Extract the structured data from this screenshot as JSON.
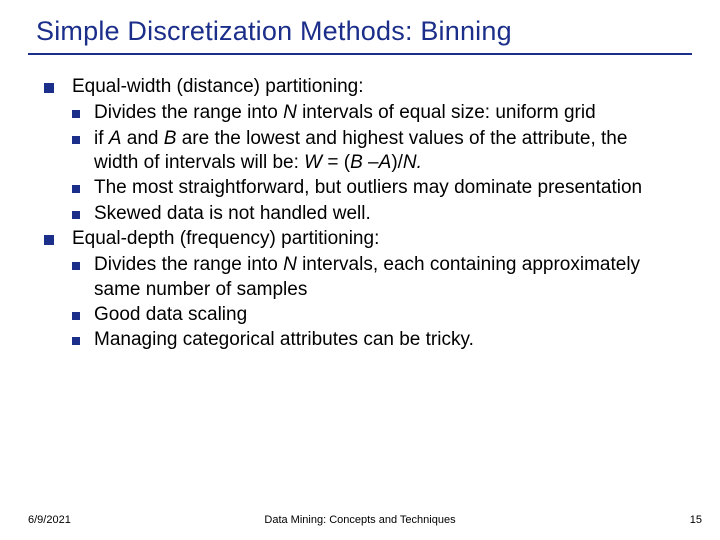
{
  "title": "Simple Discretization Methods: Binning",
  "top": {
    "a": {
      "head": "Equal-width (distance) partitioning:",
      "s1a": "Divides the range into ",
      "s1b": "N",
      "s1c": " intervals of equal size: uniform grid",
      "s2a": "if ",
      "s2b": "A",
      "s2c": " and ",
      "s2d": "B",
      "s2e": " are the lowest and highest values of the attribute, the width of intervals will be: ",
      "s2f": "W",
      "s2g": " = (",
      "s2h": "B",
      "s2i": " –",
      "s2j": "A",
      "s2k": ")/",
      "s2l": "N.",
      "s3": "The most straightforward, but outliers may dominate presentation",
      "s4": "Skewed data is not handled well."
    },
    "b": {
      "head": "Equal-depth (frequency) partitioning:",
      "s1a": "Divides the range into ",
      "s1b": "N",
      "s1c": " intervals, each containing approximately same number of samples",
      "s2": "Good data scaling",
      "s3": "Managing categorical attributes can be tricky."
    }
  },
  "footer": {
    "date": "6/9/2021",
    "center": "Data Mining: Concepts and Techniques",
    "num": "15"
  }
}
